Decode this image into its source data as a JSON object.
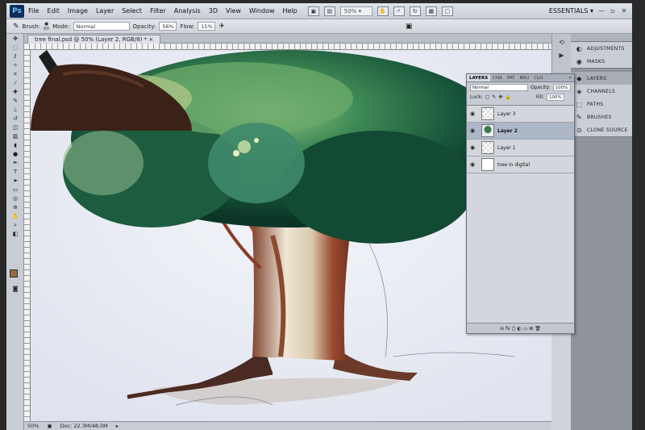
{
  "app": {
    "logo": "Ps",
    "workspace": "ESSENTIALS"
  },
  "menu": [
    "File",
    "Edit",
    "Image",
    "Layer",
    "Select",
    "Filter",
    "Analysis",
    "3D",
    "View",
    "Window",
    "Help"
  ],
  "menubar": {
    "zoom": "50%",
    "zoom_arrow": "▾",
    "workspace_arrow": "▾"
  },
  "window_controls": {
    "minimize": "—",
    "restore": "▫",
    "close": "✕"
  },
  "options": {
    "brush_label": "Brush:",
    "brush_size": "60",
    "mode_label": "Mode:",
    "mode_value": "Normal",
    "opacity_label": "Opacity:",
    "opacity_value": "56%",
    "flow_label": "Flow:",
    "flow_value": "15%"
  },
  "document_tab": "tree final.psd @ 50% (Layer 2, RGB/8) *",
  "status": {
    "zoom": "50%",
    "doc": "Doc: 22.3M/48.0M"
  },
  "dock": {
    "items": [
      {
        "label": "ADJUSTMENTS",
        "icon": "◐"
      },
      {
        "label": "MASKS",
        "icon": "◉"
      },
      {
        "label": "LAYERS",
        "icon": "◆"
      },
      {
        "label": "CHANNELS",
        "icon": "◈"
      },
      {
        "label": "PATHS",
        "icon": "⬚"
      },
      {
        "label": "BRUSHES",
        "icon": "✎"
      },
      {
        "label": "CLONE SOURCE",
        "icon": "⊙"
      }
    ]
  },
  "layers_panel": {
    "tabs": [
      "LAYERS",
      "CHA",
      "PAT",
      "BRU",
      "CLO"
    ],
    "tab_controls": "»",
    "blend_mode": "Normal",
    "opacity_label": "Opacity:",
    "opacity_value": "100%",
    "lock_label": "Lock:",
    "fill_label": "Fill:",
    "fill_value": "100%",
    "layers": [
      {
        "name": "Layer 3",
        "selected": false,
        "thumb": "transparent"
      },
      {
        "name": "Layer 2",
        "selected": true,
        "thumb": "tree"
      },
      {
        "name": "Layer 1",
        "selected": false,
        "thumb": "transparent"
      },
      {
        "name": "tree in digital",
        "selected": false,
        "thumb": "white"
      }
    ],
    "footer_icons": "⊖  fx  ◻  ◐  ▭  ⊞  🗑"
  }
}
